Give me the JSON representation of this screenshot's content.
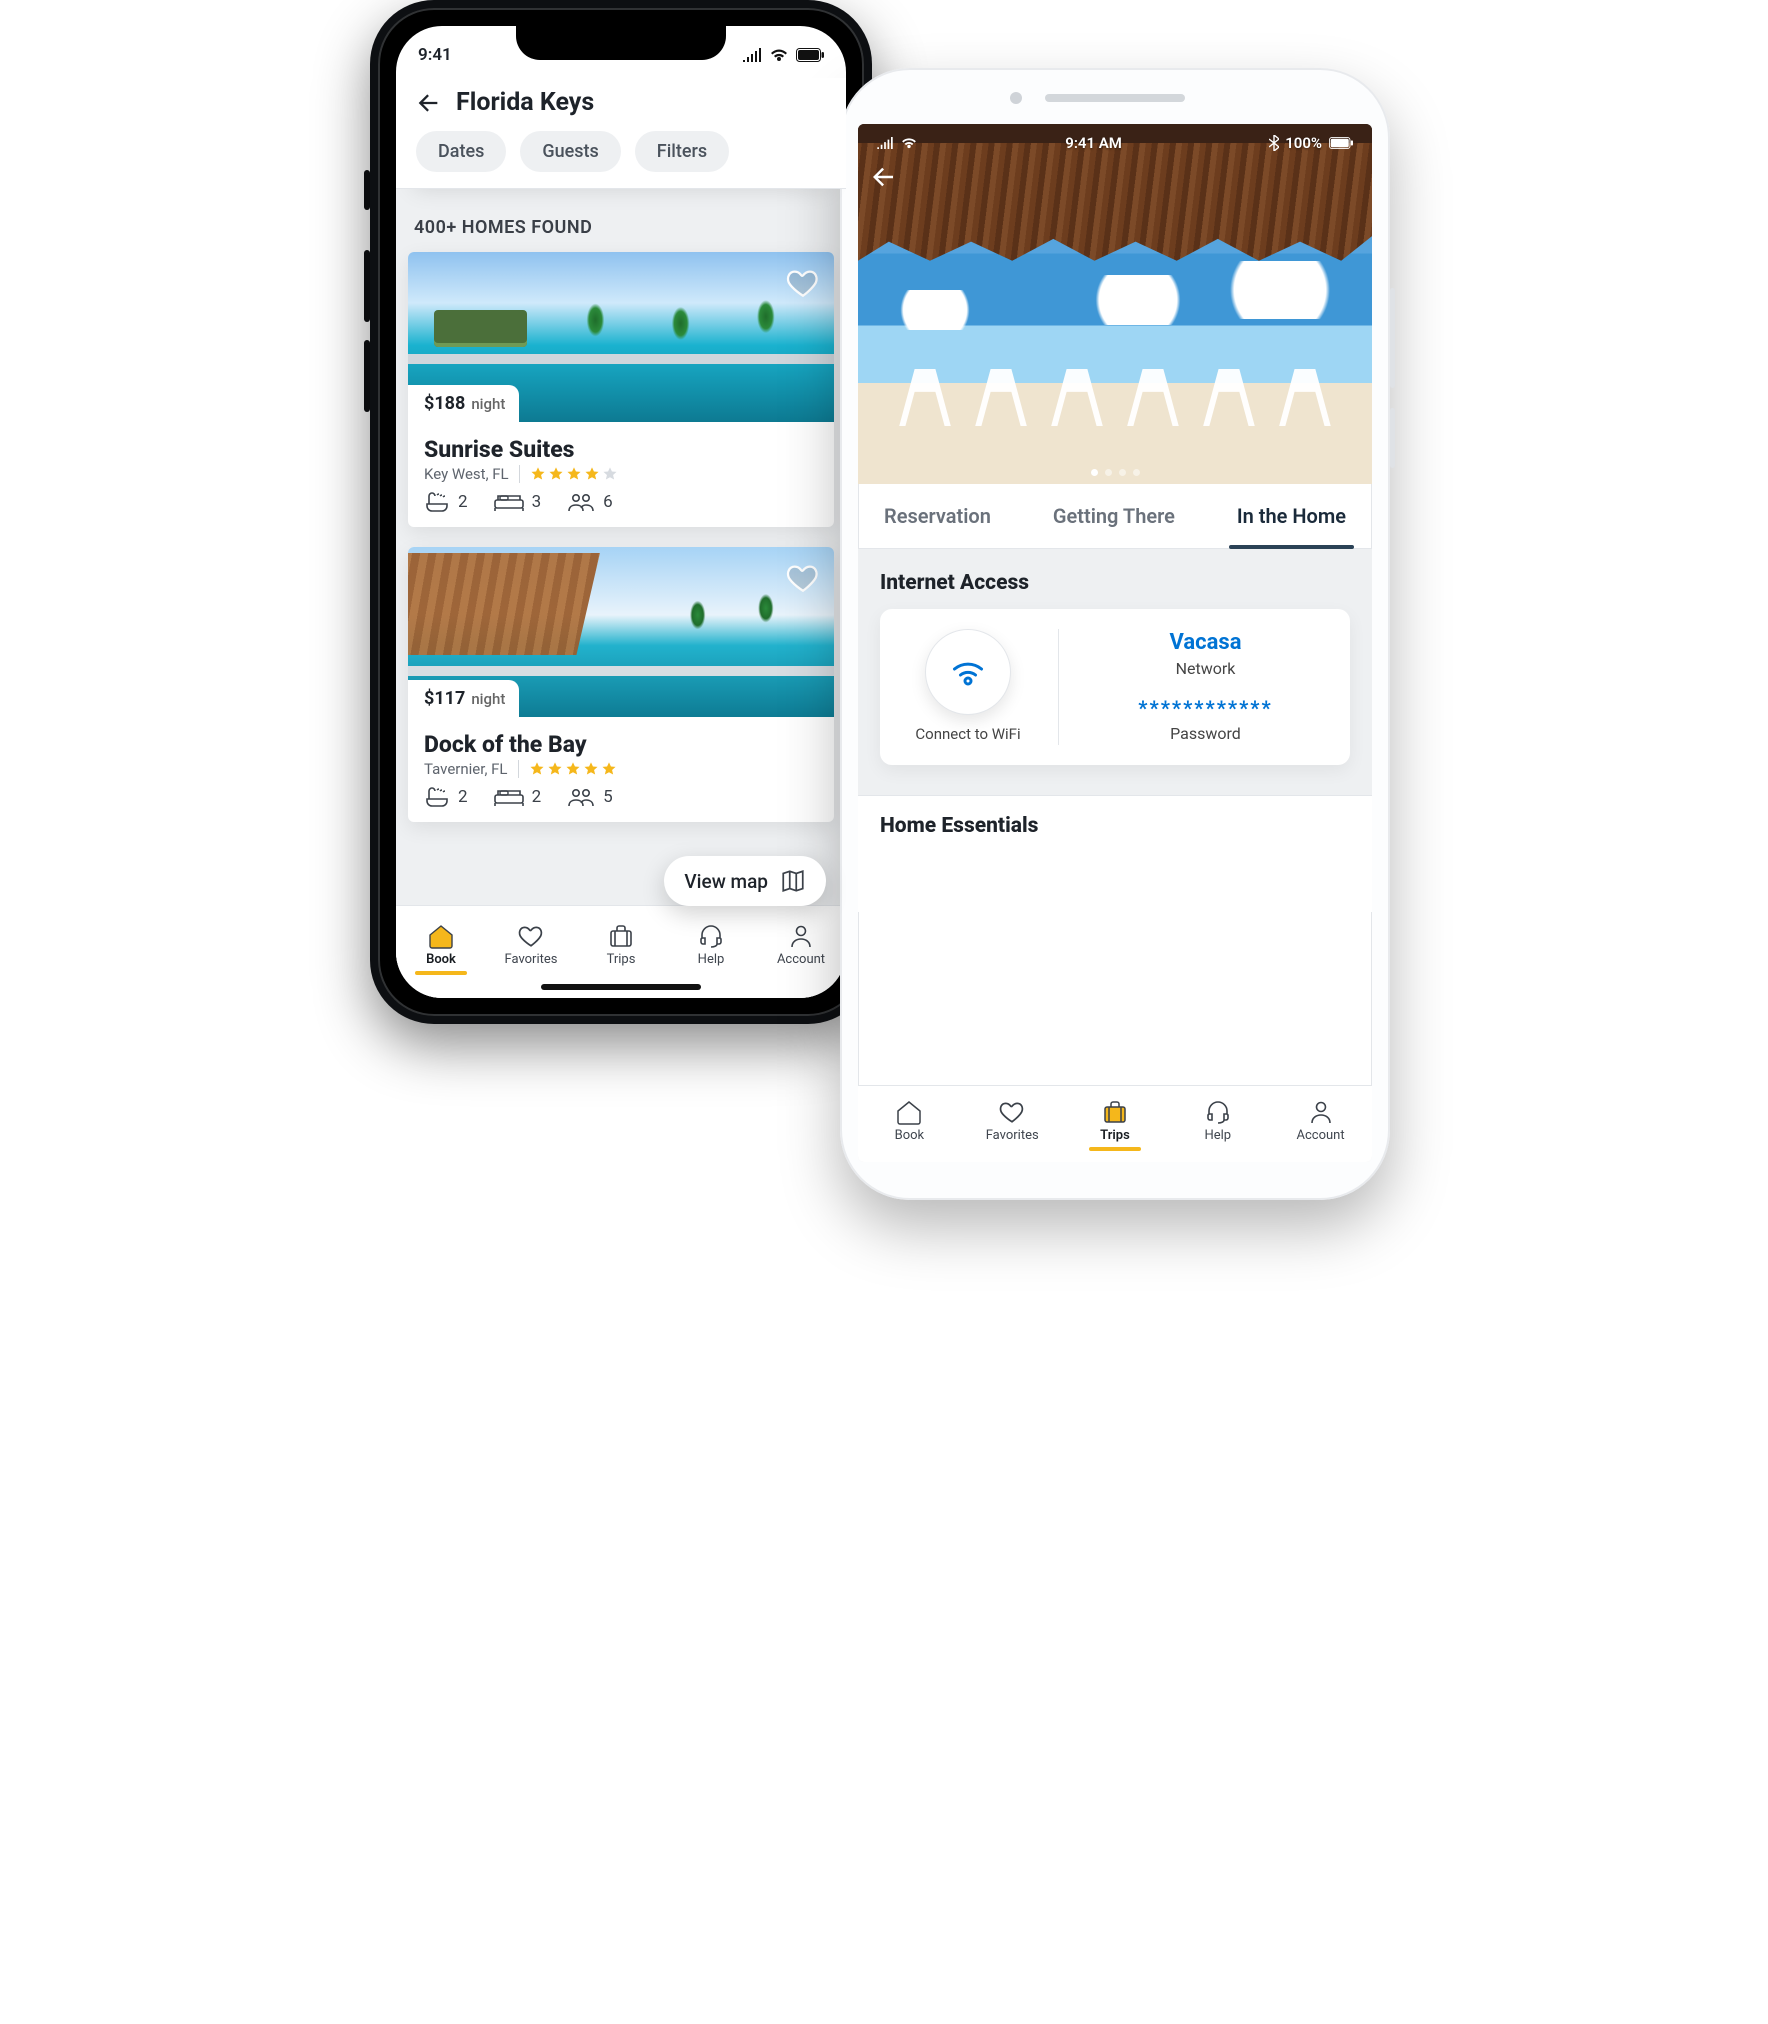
{
  "left": {
    "status": {
      "time": "9:41"
    },
    "header": {
      "title": "Florida Keys",
      "chips": {
        "dates": "Dates",
        "guests": "Guests",
        "filters": "Filters"
      }
    },
    "found": "400+ HOMES FOUND",
    "listings": [
      {
        "price": "$188",
        "price_sub": "night",
        "name": "Sunrise Suites",
        "loc": "Key West, FL",
        "stars": 4,
        "bath": "2",
        "bed": "3",
        "guests": "6"
      },
      {
        "price": "$117",
        "price_sub": "night",
        "name": "Dock of the Bay",
        "loc": "Tavernier, FL",
        "stars": 5,
        "bath": "2",
        "bed": "2",
        "guests": "5"
      }
    ],
    "viewmap": "View map",
    "tabs": {
      "book": "Book",
      "favorites": "Favorites",
      "trips": "Trips",
      "help": "Help",
      "account": "Account"
    }
  },
  "right": {
    "status": {
      "time": "9:41 AM",
      "battery": "100%"
    },
    "tabs": {
      "reservation": "Reservation",
      "getting": "Getting There",
      "inhome": "In the Home"
    },
    "internet": {
      "title": "Internet Access",
      "connect": "Connect to WiFi",
      "network_name": "Vacasa",
      "network_label": "Network",
      "password_masked": "************",
      "password_label": "Password"
    },
    "essentials_title": "Home Essentials",
    "tabs_bottom": {
      "book": "Book",
      "favorites": "Favorites",
      "trips": "Trips",
      "help": "Help",
      "account": "Account"
    }
  }
}
